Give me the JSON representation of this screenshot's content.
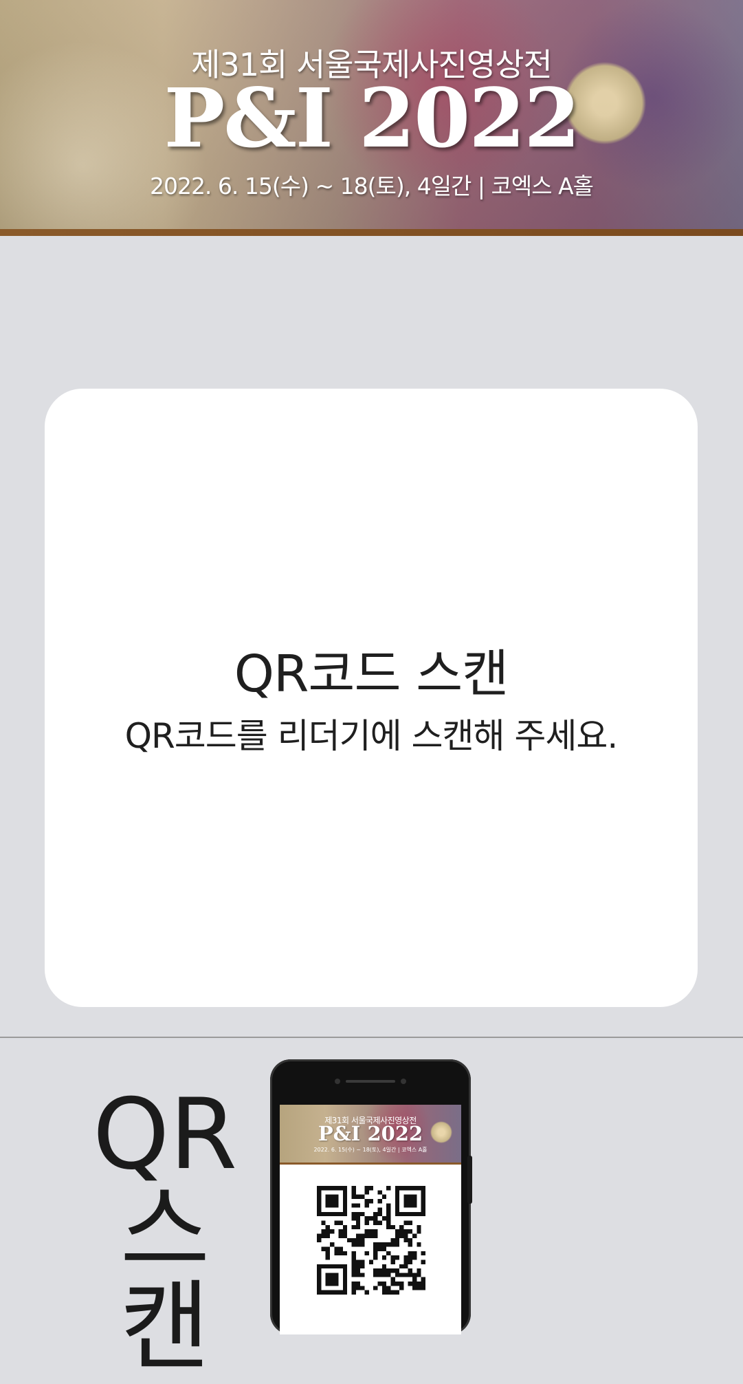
{
  "banner": {
    "subtitle": "제31회 서울국제사진영상전",
    "title": "P&I 2022",
    "date": "2022. 6. 15(수) ~ 18(토), 4일간 | 코엑스 A홀"
  },
  "card": {
    "title": "QR코드 스캔",
    "message": "QR코드를 리더기에 스캔해 주세요."
  },
  "bottom": {
    "label_line1": "QR",
    "label_line2": "스캔"
  },
  "phone_screen": {
    "subtitle": "제31회 서울국제사진영상전",
    "title": "P&I 2022",
    "date": "2022. 6. 15(수) ~ 18(토), 4일간 | 코엑스 A홀",
    "qr_icon": "qr-code-icon"
  },
  "colors": {
    "background": "#dddee2",
    "card": "#ffffff",
    "banner_bar": "#8a5a2a",
    "text": "#1f1f1f"
  }
}
